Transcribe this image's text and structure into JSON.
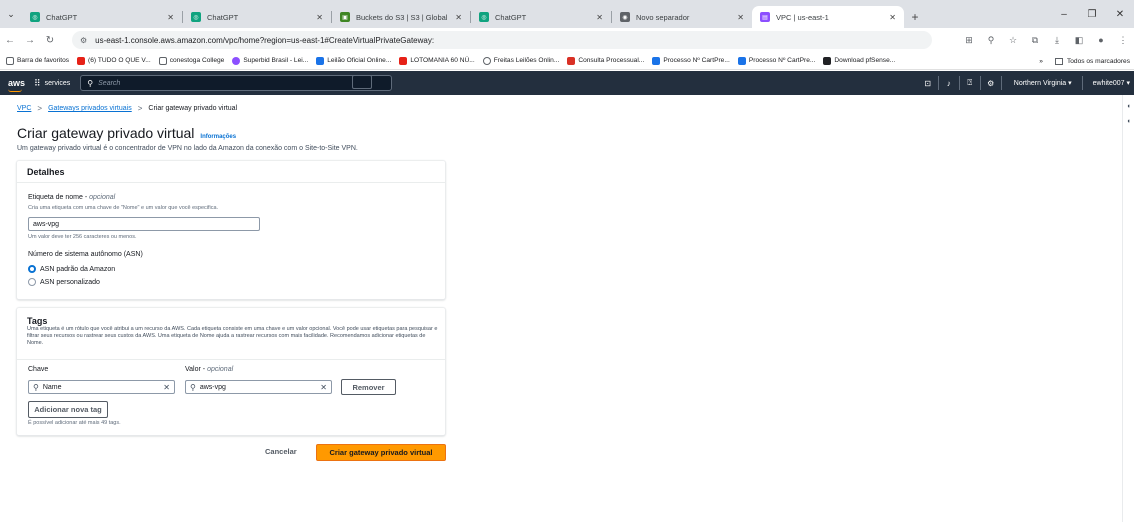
{
  "browser": {
    "tabs": [
      {
        "title": "ChatGPT",
        "favicon_color": "#10a37f",
        "active": false
      },
      {
        "title": "ChatGPT",
        "favicon_color": "#10a37f",
        "active": false
      },
      {
        "title": "Buckets do S3 | S3 | Global",
        "favicon_color": "#3f8624",
        "active": false
      },
      {
        "title": "ChatGPT",
        "favicon_color": "#10a37f",
        "active": false
      },
      {
        "title": "Novo separador",
        "favicon_color": "#5f6368",
        "active": false
      },
      {
        "title": "VPC | us-east-1",
        "favicon_color": "#8c4fff",
        "active": true
      }
    ],
    "url": "us-east-1.console.aws.amazon.com/vpc/home?region=us-east-1#CreateVirtualPrivateGateway:",
    "bookmarks": [
      {
        "label": "Barra de favoritos",
        "color": "#5f6368"
      },
      {
        "label": "(6) TUDO O QUE V...",
        "color": "#e62117"
      },
      {
        "label": "conestoga College",
        "color": "#5f6368"
      },
      {
        "label": "Superbid Brasil - Lei...",
        "color": "#8c4fff"
      },
      {
        "label": "Leilão Oficial Online...",
        "color": "#1a73e8"
      },
      {
        "label": "LOTOMANIA 60 NÚ...",
        "color": "#e62117"
      },
      {
        "label": "Freitas Leilões Onlin...",
        "color": "#5f6368"
      },
      {
        "label": "Consulta Processual...",
        "color": "#d93025"
      },
      {
        "label": "Processo Nº CartPre...",
        "color": "#1a73e8"
      },
      {
        "label": "Processo Nº CartPre...",
        "color": "#1a73e8"
      },
      {
        "label": "Download pfSense...",
        "color": "#202124"
      }
    ],
    "bookmarks_overflow": "»",
    "all_bookmarks": "Todos os marcadores"
  },
  "aws": {
    "logo": "aws",
    "services": "services",
    "search_placeholder": "Search",
    "region": "Northern Virginia ▾",
    "account": "ewhite007 ▾"
  },
  "breadcrumb": {
    "root": "VPC",
    "parent": "Gateways privados virtuais",
    "current": "Criar gateway privado virtual"
  },
  "page": {
    "title": "Criar gateway privado virtual",
    "info": "Informações",
    "description": "Um gateway privado virtual é o concentrador de VPN no lado da Amazon da conexão com o Site-to-Site VPN."
  },
  "details": {
    "heading": "Detalhes",
    "name_label": "Etiqueta de nome",
    "name_optional": "opcional",
    "name_hint": "Cria uma etiqueta com uma chave de \"Nome\" e um valor que você especifica.",
    "name_value": "aws-vpg",
    "name_constraint": "Um valor deve ter 256 caracteres ou menos.",
    "asn_label": "Número de sistema autônomo (ASN)",
    "asn_options": [
      {
        "label": "ASN padrão da Amazon",
        "selected": true
      },
      {
        "label": "ASN personalizado",
        "selected": false
      }
    ]
  },
  "tags": {
    "heading": "Tags",
    "description": "Uma etiqueta é um rótulo que você atribui a um recurso da AWS. Cada etiqueta consiste em uma chave e um valor opcional. Você pode usar etiquetas para pesquisar e filtrar seus recursos ou rastrear seus custos da AWS. Uma etiqueta de Nome ajuda a rastrear recursos com mais facilidade. Recomendamos adicionar etiquetas de Nome.",
    "key_label": "Chave",
    "value_label": "Valor",
    "value_optional": "opcional",
    "key_value": "Name",
    "value_value": "aws-vpg",
    "remove_button": "Remover",
    "add_button": "Adicionar nova tag",
    "limit_hint": "É possível adicionar até mais 49 tags."
  },
  "actions": {
    "cancel": "Cancelar",
    "submit": "Criar gateway privado virtual"
  }
}
